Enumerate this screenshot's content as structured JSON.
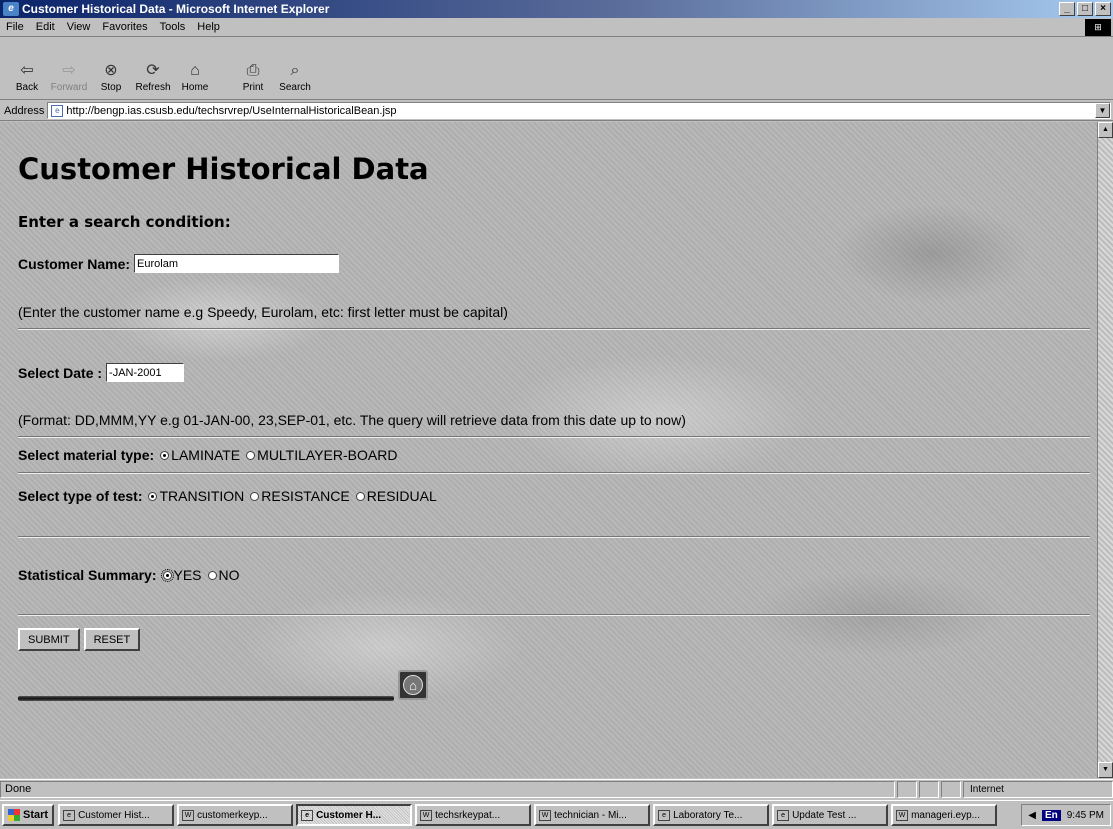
{
  "window": {
    "title": "Customer Historical Data - Microsoft Internet Explorer",
    "controls": [
      "_",
      "□",
      "×"
    ]
  },
  "menu": [
    "File",
    "Edit",
    "View",
    "Favorites",
    "Tools",
    "Help"
  ],
  "toolbar": [
    {
      "label": "Back",
      "icon": "⇦",
      "enabled": true
    },
    {
      "label": "Forward",
      "icon": "⇨",
      "enabled": false
    },
    {
      "label": "Stop",
      "icon": "⊗",
      "enabled": true
    },
    {
      "label": "Refresh",
      "icon": "⟳",
      "enabled": true
    },
    {
      "label": "Home",
      "icon": "⌂",
      "enabled": true
    },
    {
      "label": "Print",
      "icon": "⎙",
      "enabled": true
    },
    {
      "label": "Search",
      "icon": "⌕",
      "enabled": true
    }
  ],
  "address": {
    "label": "Address",
    "url": "http://bengp.ias.csusb.edu/techsrvrep/UseInternalHistoricalBean.jsp"
  },
  "page": {
    "heading": "Customer Historical Data",
    "subheading": "Enter a search condition:",
    "customer_label": "Customer Name:",
    "customer_value": "Eurolam",
    "customer_hint": "(Enter the customer name e.g Speedy, Eurolam, etc: first letter must be capital)",
    "date_label": "Select Date :",
    "date_value": "-JAN-2001",
    "date_hint": "(Format: DD,MMM,YY e.g 01-JAN-00, 23,SEP-01, etc. The query will retrieve data from this date up to now)",
    "material_label": "Select material type:",
    "material_options": [
      "LAMINATE",
      "MULTILAYER-BOARD"
    ],
    "material_selected": "LAMINATE",
    "test_label": "Select type of test:",
    "test_options": [
      "TRANSITION",
      "RESISTANCE",
      "RESIDUAL"
    ],
    "test_selected": "TRANSITION",
    "summary_label": "Statistical Summary:",
    "summary_options": [
      "YES",
      "NO"
    ],
    "summary_selected": "YES",
    "submit_label": "SUBMIT",
    "reset_label": "RESET"
  },
  "status": {
    "text": "Done",
    "zone": "Internet"
  },
  "taskbar": {
    "start": "Start",
    "tasks": [
      "Customer Hist...",
      "customerkeyp...",
      "Customer H...",
      "techsrkeypat...",
      "technician - Mi...",
      "Laboratory Te...",
      "Update Test ...",
      "manageri.eyp..."
    ],
    "active_index": 2,
    "lang": "En",
    "clock": "9:45 PM"
  }
}
